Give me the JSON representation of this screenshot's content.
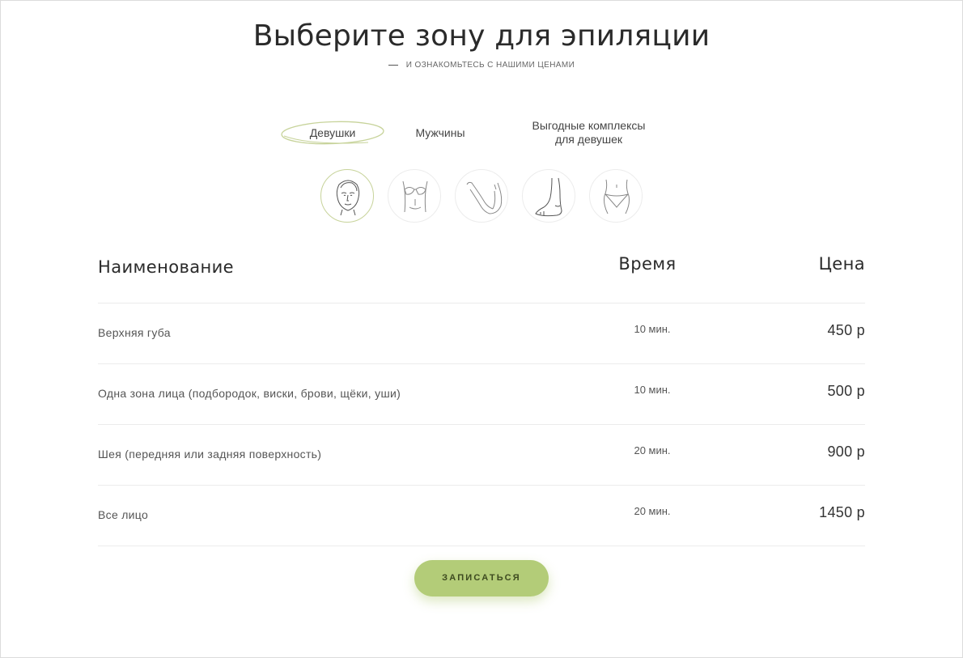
{
  "header": {
    "title": "Выберите зону для эпиляции",
    "subtitle": "И ОЗНАКОМЬТЕСЬ С НАШИМИ ЦЕНАМИ"
  },
  "tabs": [
    {
      "label": "Девушки",
      "active": true
    },
    {
      "label": "Мужчины",
      "active": false
    },
    {
      "label_line1": "Выгодные комплексы",
      "label_line2": "для девушек",
      "active": false
    }
  ],
  "zones": [
    {
      "icon": "face-icon",
      "active": true
    },
    {
      "icon": "bikini-top-icon",
      "active": false
    },
    {
      "icon": "arm-icon",
      "active": false
    },
    {
      "icon": "leg-icon",
      "active": false
    },
    {
      "icon": "bikini-icon",
      "active": false
    }
  ],
  "table": {
    "columns": {
      "name": "Наименование",
      "time": "Время",
      "price": "Цена"
    },
    "rows": [
      {
        "name": "Верхняя губа",
        "time": "10 мин.",
        "price": "450 р"
      },
      {
        "name": "Одна зона лица (подбородок, виски, брови, щёки, уши)",
        "time": "10 мин.",
        "price": "500 р"
      },
      {
        "name": "Шея (передняя или задняя поверхность)",
        "time": "20 мин.",
        "price": "900 р"
      },
      {
        "name": "Все лицо",
        "time": "20 мин.",
        "price": "1450 р"
      }
    ]
  },
  "cta": {
    "label": "ЗАПИСАТЬСЯ"
  },
  "colors": {
    "accent": "#b3cc78",
    "active_ring": "#c7d39a",
    "divider": "#ececec",
    "text": "#333333"
  }
}
